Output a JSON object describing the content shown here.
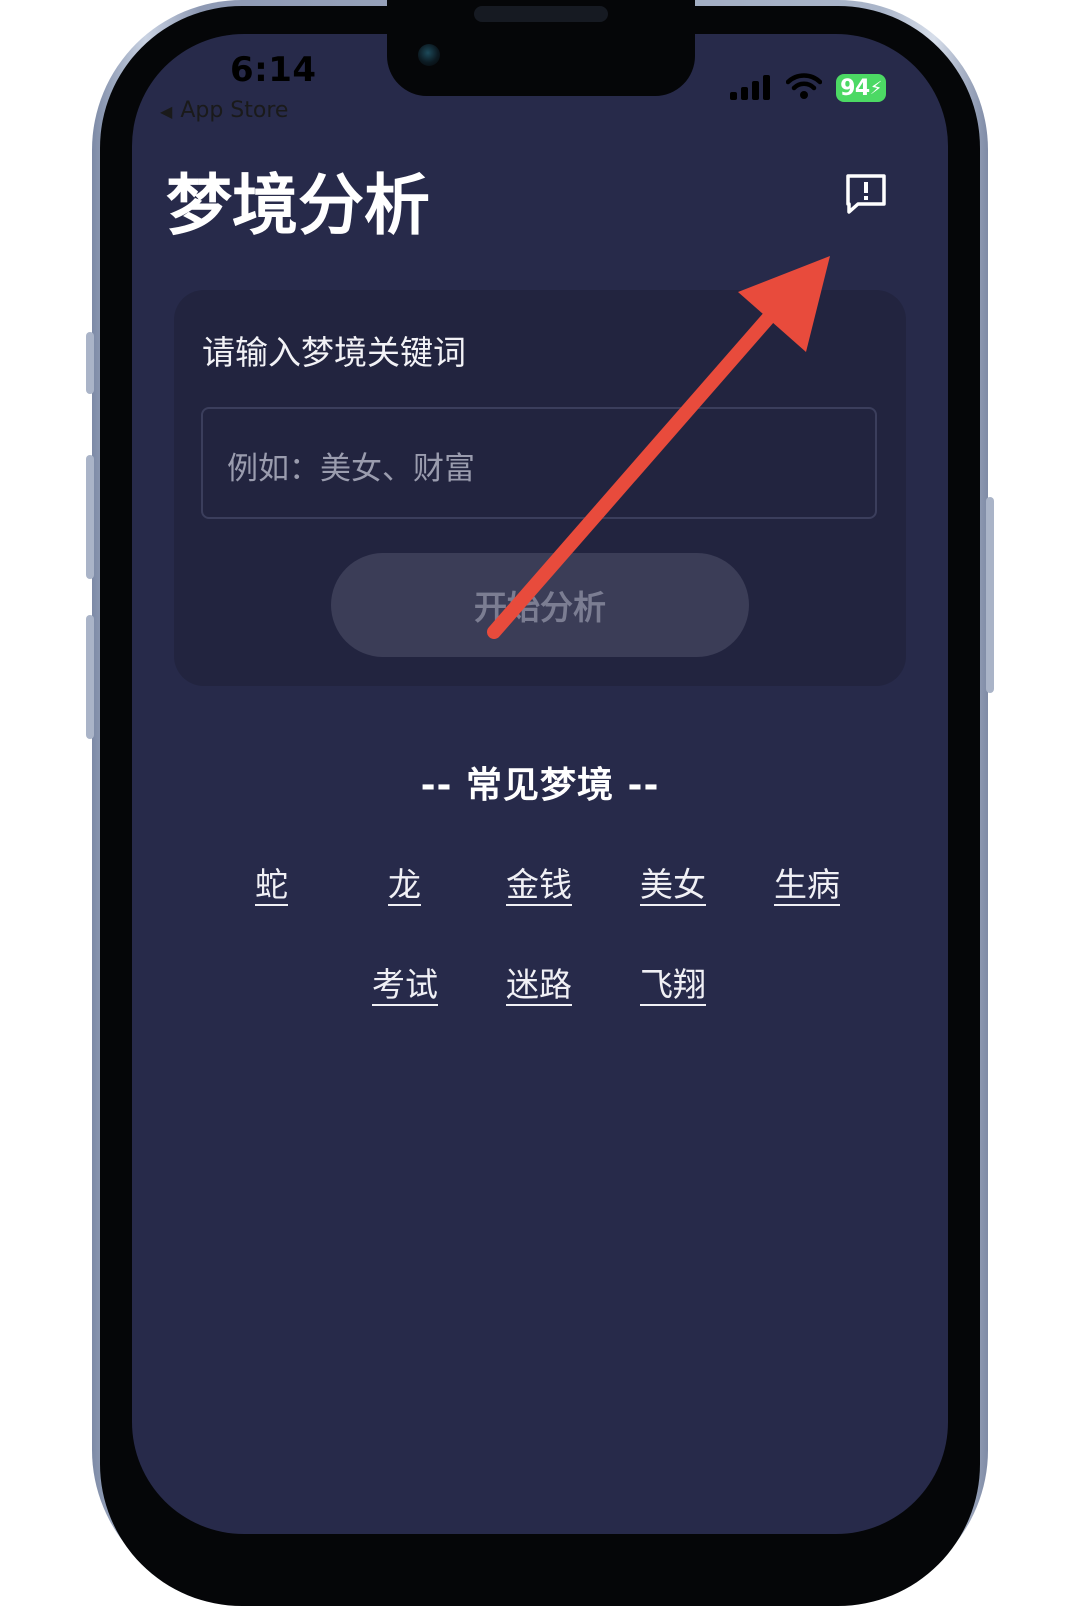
{
  "status_bar": {
    "time": "6:14",
    "back_label": "App Store",
    "battery": "94"
  },
  "header": {
    "title": "梦境分析",
    "feedback_icon": "message-exclamation-icon"
  },
  "search_card": {
    "label": "请输入梦境关键词",
    "input_placeholder": "例如：美女、财富",
    "submit_label": "开始分析"
  },
  "common_dreams": {
    "title": "-- 常见梦境 --",
    "tags": [
      "蛇",
      "龙",
      "金钱",
      "美女",
      "生病",
      "考试",
      "迷路",
      "飞翔"
    ]
  },
  "annotation": {
    "arrow_color": "#e84b3c"
  },
  "colors": {
    "screen_bg": "#272a4a",
    "card_bg": "#22243f",
    "button_bg": "#3b3d57"
  }
}
